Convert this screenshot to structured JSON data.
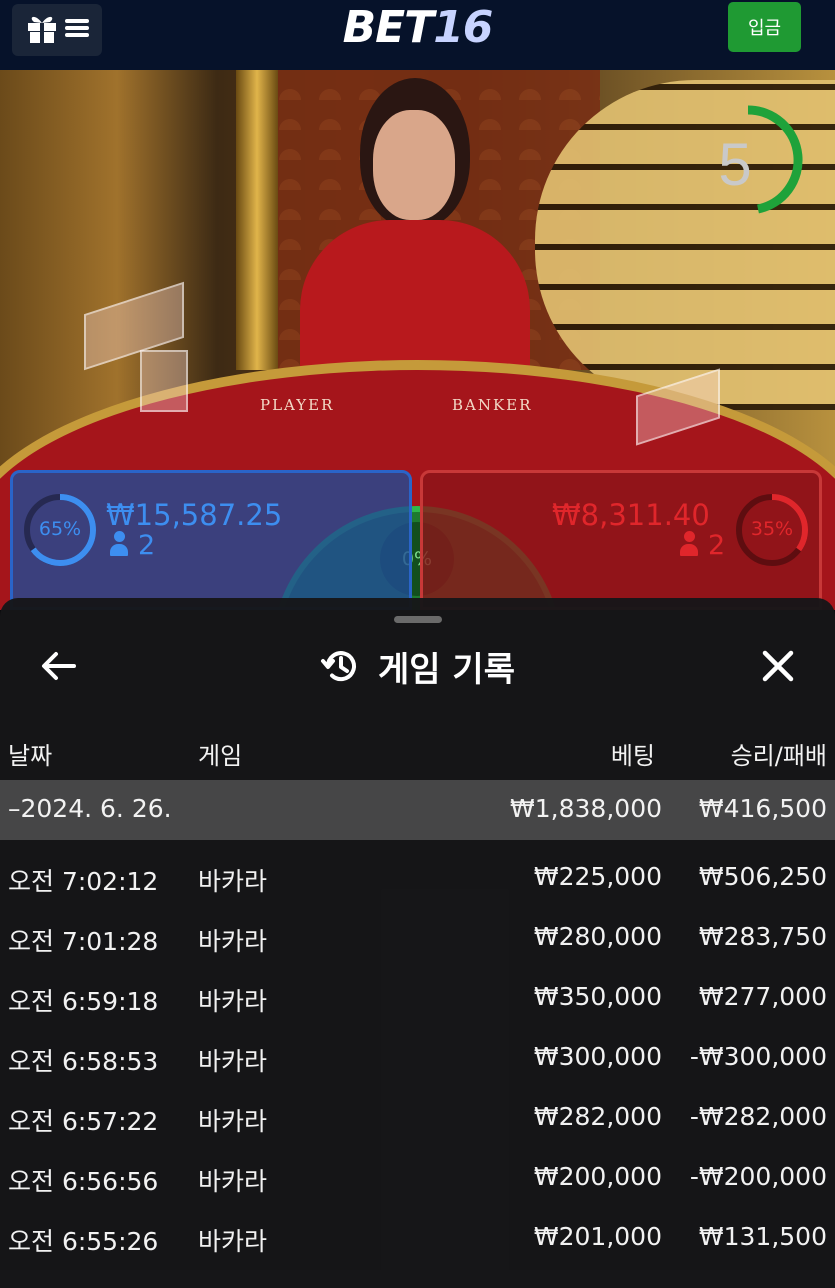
{
  "header": {
    "logo_main": "BET",
    "logo_num": "16",
    "deposit_label": "입금"
  },
  "video": {
    "countdown": "5",
    "table_player": "PLAYER",
    "table_banker": "BANKER",
    "player": {
      "pct": "65%",
      "pct_value": 0.65,
      "amount": "₩15,587.25",
      "count": "2",
      "color": "#3d8ef0"
    },
    "banker": {
      "pct": "35%",
      "pct_value": 0.35,
      "amount": "₩8,311.40",
      "count": "2",
      "color": "#e0262b"
    },
    "tie": {
      "pct": "0%"
    }
  },
  "history": {
    "title": "게임 기록",
    "columns": {
      "date": "날짜",
      "game": "게임",
      "bet": "베팅",
      "result": "승리/패배"
    },
    "summary": {
      "date": "–2024. 6. 26.",
      "bet": "₩1,838,000",
      "result": "₩416,500"
    },
    "rows": [
      {
        "time": "오전 7:02:12",
        "game": "바카라",
        "bet": "₩225,000",
        "result": "₩506,250"
      },
      {
        "time": "오전 7:01:28",
        "game": "바카라",
        "bet": "₩280,000",
        "result": "₩283,750"
      },
      {
        "time": "오전 6:59:18",
        "game": "바카라",
        "bet": "₩350,000",
        "result": "₩277,000"
      },
      {
        "time": "오전 6:58:53",
        "game": "바카라",
        "bet": "₩300,000",
        "result": "-₩300,000"
      },
      {
        "time": "오전 6:57:22",
        "game": "바카라",
        "bet": "₩282,000",
        "result": "-₩282,000"
      },
      {
        "time": "오전 6:56:56",
        "game": "바카라",
        "bet": "₩200,000",
        "result": "-₩200,000"
      },
      {
        "time": "오전 6:55:26",
        "game": "바카라",
        "bet": "₩201,000",
        "result": "₩131,500"
      }
    ]
  }
}
